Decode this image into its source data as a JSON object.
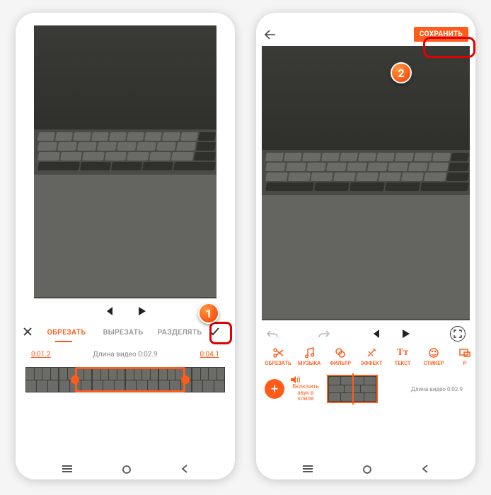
{
  "badges": {
    "step1": "1",
    "step2": "2"
  },
  "left": {
    "tabs": {
      "trim": "ОБРЕЗАТЬ",
      "cut": "ВЫРЕЗАТЬ",
      "split": "РАЗДЕЛЯТЬ"
    },
    "time": {
      "start": "0:01.2",
      "length_label": "Длина видео 0:02.9",
      "end": "0:04.1"
    }
  },
  "right": {
    "save": "СОХРАНИТЬ",
    "tools": {
      "trim": "ОБРЕЗАТЬ",
      "music": "МУЗЫКА",
      "filter": "ФИЛЬТР",
      "effect": "ЭФФЕКТ",
      "text": "ТЕКСТ",
      "sticker": "СТИКЕР",
      "pip": "Р"
    },
    "mute": {
      "line1": "Включить",
      "line2": "звук в клипе"
    },
    "length_label": "Длина видео 0:02.9"
  }
}
